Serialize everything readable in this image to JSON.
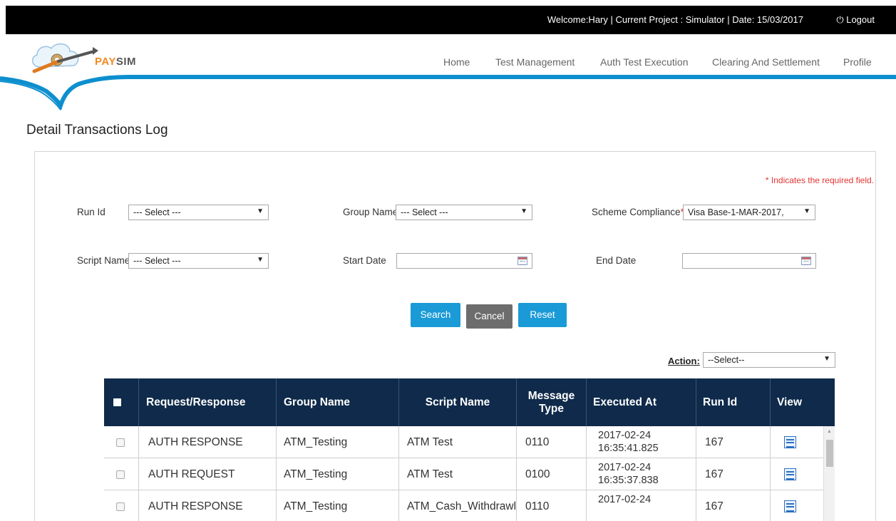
{
  "topbar": {
    "welcome_text": "Welcome:Hary  |  Current Project : Simulator  |  Date: 15/03/2017",
    "logout_label": "⏻ Logout"
  },
  "brand": {
    "pay": "PAY",
    "sim": "SIM"
  },
  "nav": {
    "items": [
      "Home",
      "Test Management",
      "Auth Test Execution",
      "Clearing And Settlement",
      "Profile"
    ]
  },
  "page": {
    "title": "Detail Transactions Log"
  },
  "form": {
    "required_note": "* Indicates the required field.",
    "run_id": {
      "label": "Run Id",
      "value": "--- Select ---"
    },
    "group_name": {
      "label": "Group Name",
      "value": "--- Select ---"
    },
    "scheme_compliance": {
      "label": "Scheme Compliance",
      "required_mark": "*",
      "value": "Visa Base-1-MAR-2017,"
    },
    "script_name": {
      "label": "Script Name",
      "value": "--- Select ---"
    },
    "start_date": {
      "label": "Start Date",
      "value": ""
    },
    "end_date": {
      "label": "End Date",
      "value": ""
    },
    "buttons": {
      "search": "Search",
      "cancel": "Cancel",
      "reset": "Reset"
    },
    "action": {
      "label": "Action:",
      "value": "--Select--"
    }
  },
  "table": {
    "headers": [
      "Request/Response",
      "Group Name",
      "Script Name",
      "Message Type",
      "Executed At",
      "Run Id",
      "View"
    ],
    "rows": [
      {
        "request_response": "AUTH RESPONSE",
        "group_name": "ATM_Testing",
        "script_name": "ATM Test",
        "message_type": "0110",
        "executed_date": "2017-02-24",
        "executed_time": "16:35:41.825",
        "run_id": "167"
      },
      {
        "request_response": "AUTH REQUEST",
        "group_name": "ATM_Testing",
        "script_name": "ATM Test",
        "message_type": "0100",
        "executed_date": "2017-02-24",
        "executed_time": "16:35:37.838",
        "run_id": "167"
      },
      {
        "request_response": "AUTH RESPONSE",
        "group_name": "ATM_Testing",
        "script_name": "ATM_Cash_Withdrawl",
        "message_type": "0110",
        "executed_date": "2017-02-24",
        "executed_time": "",
        "run_id": "167"
      }
    ]
  },
  "colors": {
    "topbar": "#000000",
    "accent_blue": "#1a9ad6",
    "table_header": "#0f2a4a",
    "cancel_grey": "#6d6d6d",
    "required_red": "#e53333",
    "brand_orange": "#f08a24"
  }
}
